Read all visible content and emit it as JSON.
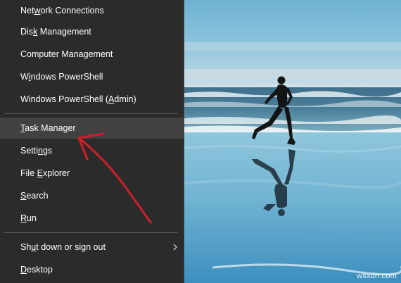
{
  "menu": {
    "items": [
      {
        "pre": "Net",
        "key": "w",
        "post": "ork Connections"
      },
      {
        "pre": "Dis",
        "key": "k",
        "post": " Management"
      },
      {
        "pre": "Computer Mana",
        "key": "g",
        "post": "ement"
      },
      {
        "pre": "W",
        "key": "i",
        "post": "ndows PowerShell"
      },
      {
        "pre": "Windows PowerShell (",
        "key": "A",
        "post": "dmin)"
      },
      {
        "pre": "",
        "key": "T",
        "post": "ask Manager"
      },
      {
        "pre": "Setti",
        "key": "n",
        "post": "gs"
      },
      {
        "pre": "File ",
        "key": "E",
        "post": "xplorer"
      },
      {
        "pre": "",
        "key": "S",
        "post": "earch"
      },
      {
        "pre": "",
        "key": "R",
        "post": "un"
      },
      {
        "pre": "Sh",
        "key": "u",
        "post": "t down or sign out"
      },
      {
        "pre": "",
        "key": "D",
        "post": "esktop"
      }
    ],
    "highlighted_item": "Task Manager",
    "submenu_icon": "chevron-right-icon"
  },
  "annotation": {
    "type": "red-arrow",
    "color": "#c8202a",
    "points_to": "Task Manager"
  },
  "wallpaper": {
    "description_icon": "beach-runner-wallpaper",
    "watermark": "wsxdn.com"
  },
  "colors": {
    "menu_bg": "#2b2b2b",
    "highlight_bg": "#414141",
    "separator": "#5a5a5a",
    "text": "#ffffff"
  }
}
